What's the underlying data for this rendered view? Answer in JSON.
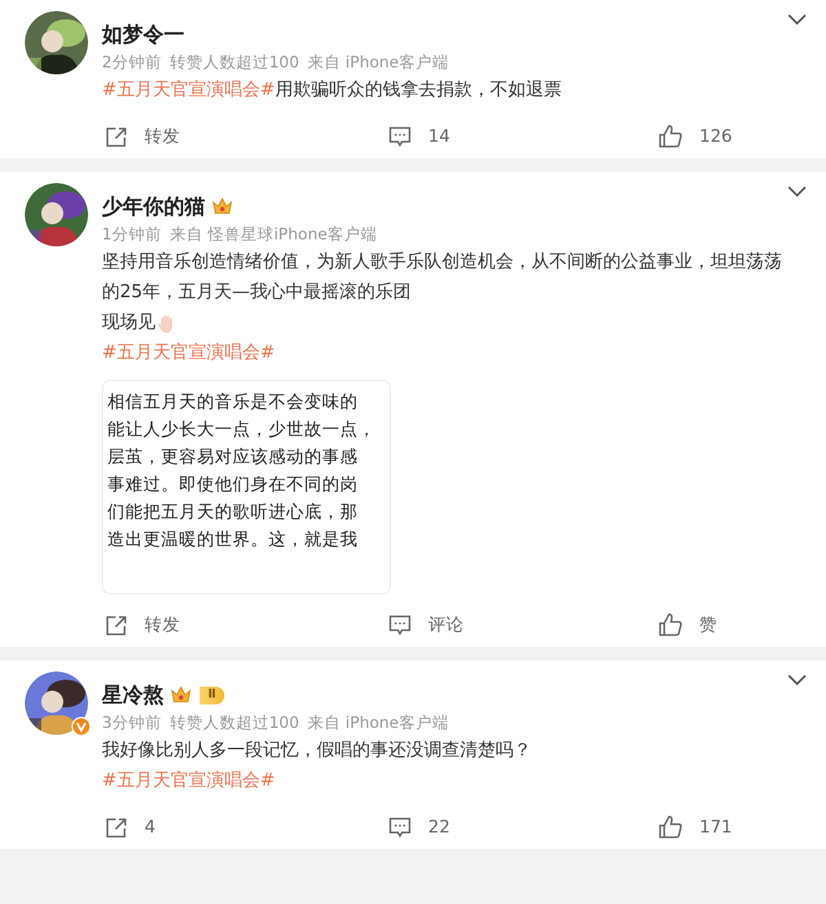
{
  "posts": [
    {
      "name": "如梦令一",
      "verified": false,
      "meta": [
        "2分钟前",
        "转赞人数超过100",
        "来自 iPhone客户端"
      ],
      "paragraphs": [
        [
          {
            "kind": "hashtag",
            "text": "#五月天官宣演唱会#"
          },
          {
            "kind": "text",
            "text": "用欺骗听众的钱拿去捐款，不如退票"
          }
        ]
      ],
      "actions": [
        {
          "kind": "repost",
          "label": "转发"
        },
        {
          "kind": "comment",
          "label": "14"
        },
        {
          "kind": "like",
          "label": "126"
        }
      ]
    },
    {
      "name": "少年你的猫",
      "verified": false,
      "badges": [
        {
          "kind": "crown"
        }
      ],
      "meta": [
        "1分钟前",
        "来自 怪兽星球iPhone客户端"
      ],
      "paragraphs": [
        [
          {
            "kind": "text",
            "text": "坚持用音乐创造情绪价值，为新人歌手乐队创造机会，从不间断的公益事业，坦坦荡荡的25年，五月天—我心中最摇滚的乐团"
          }
        ],
        [
          {
            "kind": "text",
            "text": "现场见"
          },
          {
            "kind": "emoji"
          }
        ],
        [
          {
            "kind": "hashtag",
            "text": "#五月天官宣演唱会#"
          }
        ]
      ],
      "image_card": {
        "lines": [
          "相信五月天的音乐是不会变味的",
          "能让人少长大一点，少世故一点，",
          "层茧，更容易对应该感动的事感",
          "事难过。即使他们身在不同的岗",
          "们能把五月天的歌听进心底，那",
          "造出更温暖的世界。这，就是我"
        ]
      },
      "actions": [
        {
          "kind": "repost",
          "label": "转发"
        },
        {
          "kind": "comment",
          "label": "评论"
        },
        {
          "kind": "like",
          "label": "赞"
        }
      ]
    },
    {
      "name": "星冷熬",
      "verified": true,
      "badges": [
        {
          "kind": "crown"
        },
        {
          "kind": "level",
          "text": "Ⅱ"
        }
      ],
      "meta": [
        "3分钟前",
        "转赞人数超过100",
        "来自 iPhone客户端"
      ],
      "paragraphs": [
        [
          {
            "kind": "text",
            "text": "我好像比别人多一段记忆，假唱的事还没调查清楚吗？"
          }
        ],
        [
          {
            "kind": "hashtag",
            "text": "#五月天官宣演唱会#"
          }
        ]
      ],
      "actions": [
        {
          "kind": "repost",
          "label": "4"
        },
        {
          "kind": "comment",
          "label": "22"
        },
        {
          "kind": "like",
          "label": "171"
        }
      ]
    }
  ]
}
